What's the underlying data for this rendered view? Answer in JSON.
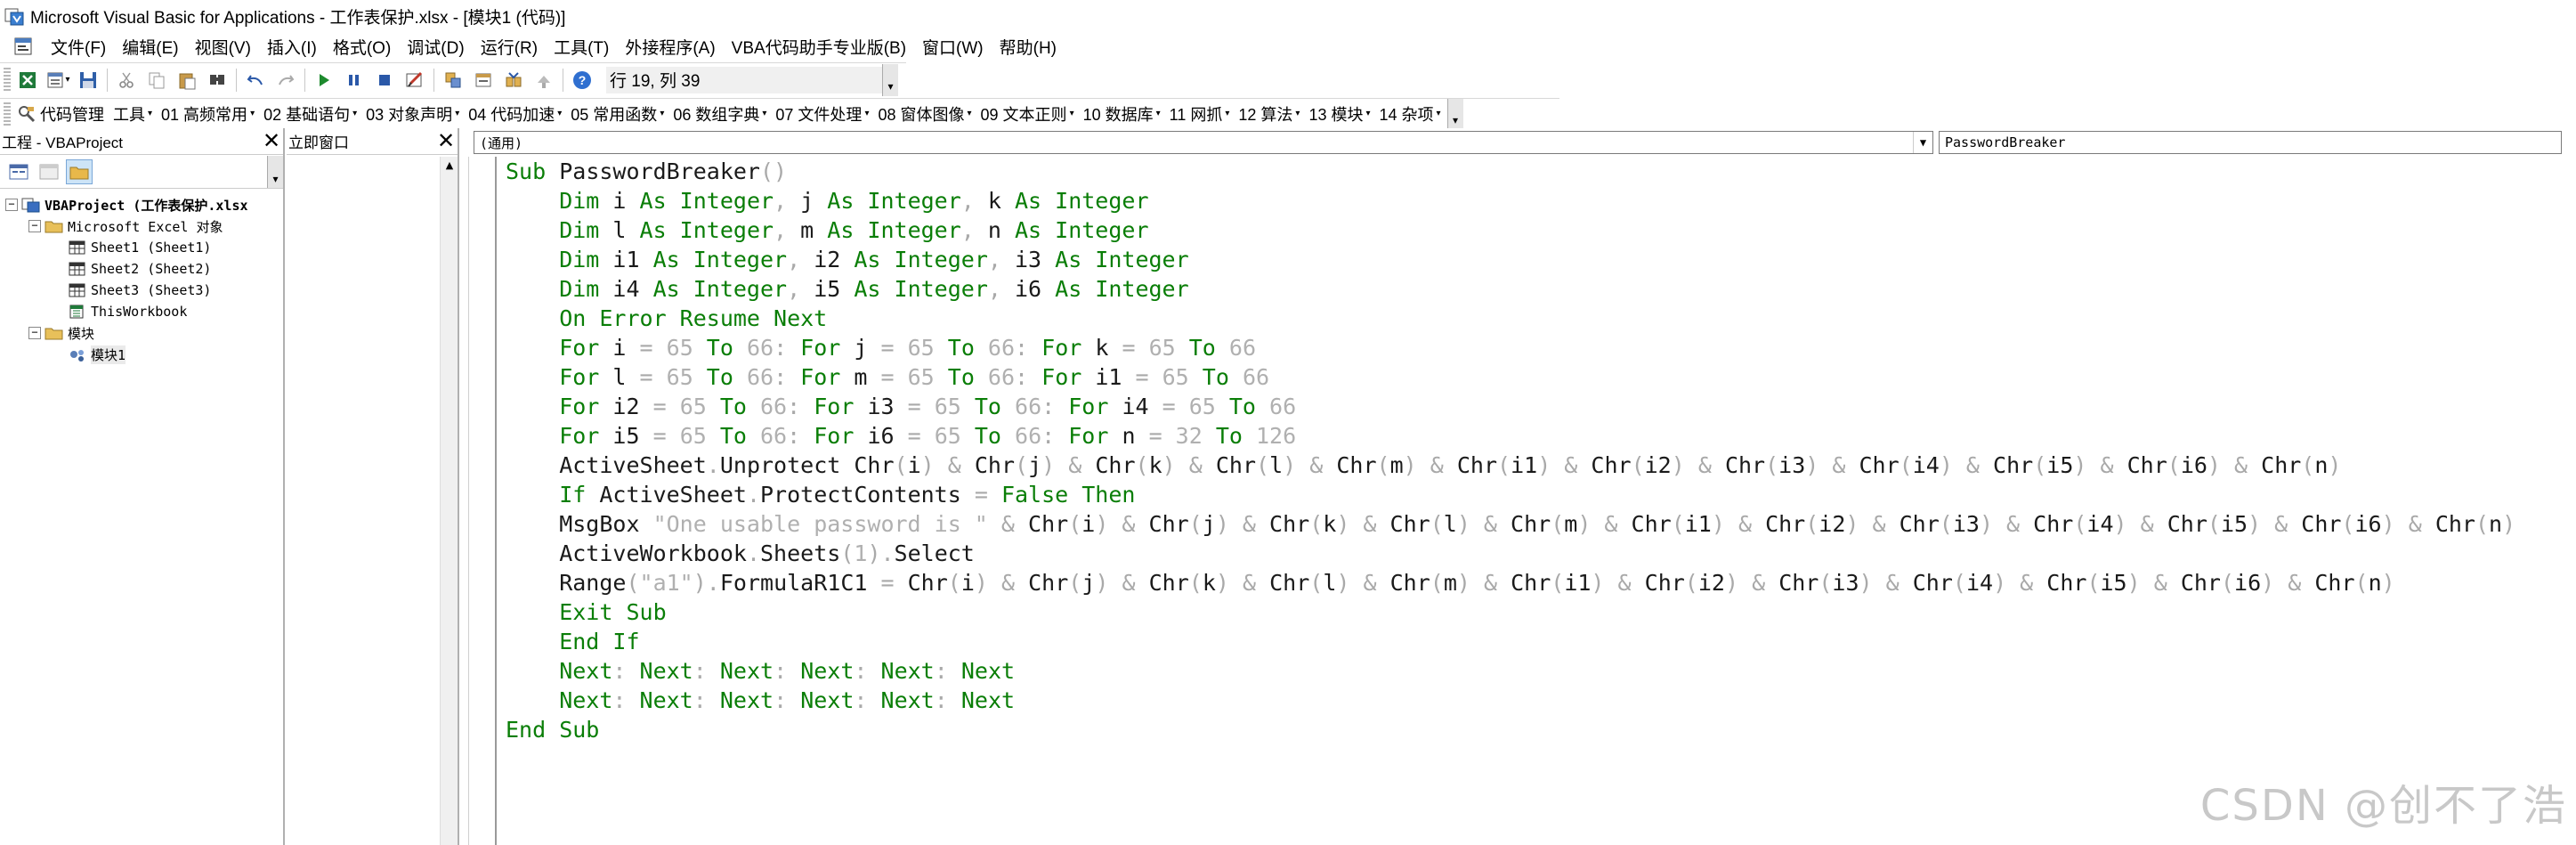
{
  "window": {
    "title": "Microsoft Visual Basic for Applications - 工作表保护.xlsx - [模块1 (代码)]"
  },
  "menu": [
    "文件(F)",
    "编辑(E)",
    "视图(V)",
    "插入(I)",
    "格式(O)",
    "调试(D)",
    "运行(R)",
    "工具(T)",
    "外接程序(A)",
    "VBA代码助手专业版(B)",
    "窗口(W)",
    "帮助(H)"
  ],
  "toolbar": {
    "icons": [
      "excel-icon",
      "insert-module-icon",
      "save-icon",
      "cut-icon",
      "copy-icon",
      "paste-icon",
      "find-icon",
      "undo-icon",
      "redo-icon",
      "run-icon",
      "break-icon",
      "reset-icon",
      "design-mode-icon",
      "project-explorer-icon",
      "properties-icon",
      "object-browser-icon",
      "toolbox-icon",
      "help-icon"
    ],
    "cursor_position": "行 19, 列 39"
  },
  "addin_toolbar": {
    "first": "代码管理",
    "items": [
      "工具",
      "01 高频常用",
      "02 基础语句",
      "03 对象声明",
      "04 代码加速",
      "05 常用函数",
      "06 数组字典",
      "07 文件处理",
      "08 窗体图像",
      "09 文本正则",
      "10 数据库",
      "11 网抓",
      "12 算法",
      "13 模块",
      "14 杂项"
    ]
  },
  "project_pane": {
    "title": "工程 - VBAProject",
    "tree": [
      {
        "label": "VBAProject (工作表保护.xlsx",
        "level": 0,
        "expander": "-",
        "icon": "vba-project-icon",
        "bold": true
      },
      {
        "label": "Microsoft Excel 对象",
        "level": 1,
        "expander": "-",
        "icon": "folder-icon"
      },
      {
        "label": "Sheet1 (Sheet1)",
        "level": 2,
        "expander": "",
        "icon": "sheet-icon"
      },
      {
        "label": "Sheet2 (Sheet2)",
        "level": 2,
        "expander": "",
        "icon": "sheet-icon"
      },
      {
        "label": "Sheet3 (Sheet3)",
        "level": 2,
        "expander": "",
        "icon": "sheet-icon"
      },
      {
        "label": "ThisWorkbook",
        "level": 2,
        "expander": "",
        "icon": "workbook-icon"
      },
      {
        "label": "模块",
        "level": 1,
        "expander": "-",
        "icon": "folder-icon"
      },
      {
        "label": "模块1",
        "level": 2,
        "expander": "",
        "icon": "module-icon",
        "selected": true
      }
    ]
  },
  "immediate_pane": {
    "title": "立即窗口"
  },
  "code_window": {
    "object_combo": "(通用)",
    "proc_combo": "PasswordBreaker",
    "lines": [
      [
        [
          "kw",
          "Sub "
        ],
        [
          "id",
          "PasswordBreaker"
        ],
        [
          "op",
          "()"
        ]
      ],
      [
        [
          "kw",
          "    Dim "
        ],
        [
          "id",
          "i "
        ],
        [
          "kw",
          "As Integer"
        ],
        [
          "op",
          ", "
        ],
        [
          "id",
          "j "
        ],
        [
          "kw",
          "As Integer"
        ],
        [
          "op",
          ", "
        ],
        [
          "id",
          "k "
        ],
        [
          "kw",
          "As Integer"
        ]
      ],
      [
        [
          "kw",
          "    Dim "
        ],
        [
          "id",
          "l "
        ],
        [
          "kw",
          "As Integer"
        ],
        [
          "op",
          ", "
        ],
        [
          "id",
          "m "
        ],
        [
          "kw",
          "As Integer"
        ],
        [
          "op",
          ", "
        ],
        [
          "id",
          "n "
        ],
        [
          "kw",
          "As Integer"
        ]
      ],
      [
        [
          "kw",
          "    Dim "
        ],
        [
          "id",
          "i1 "
        ],
        [
          "kw",
          "As Integer"
        ],
        [
          "op",
          ", "
        ],
        [
          "id",
          "i2 "
        ],
        [
          "kw",
          "As Integer"
        ],
        [
          "op",
          ", "
        ],
        [
          "id",
          "i3 "
        ],
        [
          "kw",
          "As Integer"
        ]
      ],
      [
        [
          "kw",
          "    Dim "
        ],
        [
          "id",
          "i4 "
        ],
        [
          "kw",
          "As Integer"
        ],
        [
          "op",
          ", "
        ],
        [
          "id",
          "i5 "
        ],
        [
          "kw",
          "As Integer"
        ],
        [
          "op",
          ", "
        ],
        [
          "id",
          "i6 "
        ],
        [
          "kw",
          "As Integer"
        ]
      ],
      [
        [
          "kw",
          "    On Error Resume Next"
        ]
      ],
      [
        [
          "kw",
          "    For "
        ],
        [
          "id",
          "i "
        ],
        [
          "op",
          "= "
        ],
        [
          "num",
          "65 "
        ],
        [
          "kw",
          "To "
        ],
        [
          "num",
          "66"
        ],
        [
          "op",
          ": "
        ],
        [
          "kw",
          "For "
        ],
        [
          "id",
          "j "
        ],
        [
          "op",
          "= "
        ],
        [
          "num",
          "65 "
        ],
        [
          "kw",
          "To "
        ],
        [
          "num",
          "66"
        ],
        [
          "op",
          ": "
        ],
        [
          "kw",
          "For "
        ],
        [
          "id",
          "k "
        ],
        [
          "op",
          "= "
        ],
        [
          "num",
          "65 "
        ],
        [
          "kw",
          "To "
        ],
        [
          "num",
          "66"
        ]
      ],
      [
        [
          "kw",
          "    For "
        ],
        [
          "id",
          "l "
        ],
        [
          "op",
          "= "
        ],
        [
          "num",
          "65 "
        ],
        [
          "kw",
          "To "
        ],
        [
          "num",
          "66"
        ],
        [
          "op",
          ": "
        ],
        [
          "kw",
          "For "
        ],
        [
          "id",
          "m "
        ],
        [
          "op",
          "= "
        ],
        [
          "num",
          "65 "
        ],
        [
          "kw",
          "To "
        ],
        [
          "num",
          "66"
        ],
        [
          "op",
          ": "
        ],
        [
          "kw",
          "For "
        ],
        [
          "id",
          "i1 "
        ],
        [
          "op",
          "= "
        ],
        [
          "num",
          "65 "
        ],
        [
          "kw",
          "To "
        ],
        [
          "num",
          "66"
        ]
      ],
      [
        [
          "kw",
          "    For "
        ],
        [
          "id",
          "i2 "
        ],
        [
          "op",
          "= "
        ],
        [
          "num",
          "65 "
        ],
        [
          "kw",
          "To "
        ],
        [
          "num",
          "66"
        ],
        [
          "op",
          ": "
        ],
        [
          "kw",
          "For "
        ],
        [
          "id",
          "i3 "
        ],
        [
          "op",
          "= "
        ],
        [
          "num",
          "65 "
        ],
        [
          "kw",
          "To "
        ],
        [
          "num",
          "66"
        ],
        [
          "op",
          ": "
        ],
        [
          "kw",
          "For "
        ],
        [
          "id",
          "i4 "
        ],
        [
          "op",
          "= "
        ],
        [
          "num",
          "65 "
        ],
        [
          "kw",
          "To "
        ],
        [
          "num",
          "66"
        ]
      ],
      [
        [
          "kw",
          "    For "
        ],
        [
          "id",
          "i5 "
        ],
        [
          "op",
          "= "
        ],
        [
          "num",
          "65 "
        ],
        [
          "kw",
          "To "
        ],
        [
          "num",
          "66"
        ],
        [
          "op",
          ": "
        ],
        [
          "kw",
          "For "
        ],
        [
          "id",
          "i6 "
        ],
        [
          "op",
          "= "
        ],
        [
          "num",
          "65 "
        ],
        [
          "kw",
          "To "
        ],
        [
          "num",
          "66"
        ],
        [
          "op",
          ": "
        ],
        [
          "kw",
          "For "
        ],
        [
          "id",
          "n "
        ],
        [
          "op",
          "= "
        ],
        [
          "num",
          "32 "
        ],
        [
          "kw",
          "To "
        ],
        [
          "num",
          "126"
        ]
      ],
      [
        [
          "id",
          "    ActiveSheet"
        ],
        [
          "op",
          "."
        ],
        [
          "id",
          "Unprotect Chr"
        ],
        [
          "op",
          "("
        ],
        [
          "id",
          "i"
        ],
        [
          "op",
          ") & "
        ],
        [
          "id",
          "Chr"
        ],
        [
          "op",
          "("
        ],
        [
          "id",
          "j"
        ],
        [
          "op",
          ") & "
        ],
        [
          "id",
          "Chr"
        ],
        [
          "op",
          "("
        ],
        [
          "id",
          "k"
        ],
        [
          "op",
          ") & "
        ],
        [
          "id",
          "Chr"
        ],
        [
          "op",
          "("
        ],
        [
          "id",
          "l"
        ],
        [
          "op",
          ") & "
        ],
        [
          "id",
          "Chr"
        ],
        [
          "op",
          "("
        ],
        [
          "id",
          "m"
        ],
        [
          "op",
          ") & "
        ],
        [
          "id",
          "Chr"
        ],
        [
          "op",
          "("
        ],
        [
          "id",
          "i1"
        ],
        [
          "op",
          ") & "
        ],
        [
          "id",
          "Chr"
        ],
        [
          "op",
          "("
        ],
        [
          "id",
          "i2"
        ],
        [
          "op",
          ") & "
        ],
        [
          "id",
          "Chr"
        ],
        [
          "op",
          "("
        ],
        [
          "id",
          "i3"
        ],
        [
          "op",
          ") & "
        ],
        [
          "id",
          "Chr"
        ],
        [
          "op",
          "("
        ],
        [
          "id",
          "i4"
        ],
        [
          "op",
          ") & "
        ],
        [
          "id",
          "Chr"
        ],
        [
          "op",
          "("
        ],
        [
          "id",
          "i5"
        ],
        [
          "op",
          ") & "
        ],
        [
          "id",
          "Chr"
        ],
        [
          "op",
          "("
        ],
        [
          "id",
          "i6"
        ],
        [
          "op",
          ") & "
        ],
        [
          "id",
          "Chr"
        ],
        [
          "op",
          "("
        ],
        [
          "id",
          "n"
        ],
        [
          "op",
          ")"
        ]
      ],
      [
        [
          "kw",
          "    If "
        ],
        [
          "id",
          "ActiveSheet"
        ],
        [
          "op",
          "."
        ],
        [
          "id",
          "ProtectContents "
        ],
        [
          "op",
          "= "
        ],
        [
          "kw",
          "False Then"
        ]
      ],
      [
        [
          "id",
          "    MsgBox "
        ],
        [
          "str",
          "\"One usable password is \" "
        ],
        [
          "op",
          "& "
        ],
        [
          "id",
          "Chr"
        ],
        [
          "op",
          "("
        ],
        [
          "id",
          "i"
        ],
        [
          "op",
          ") & "
        ],
        [
          "id",
          "Chr"
        ],
        [
          "op",
          "("
        ],
        [
          "id",
          "j"
        ],
        [
          "op",
          ") & "
        ],
        [
          "id",
          "Chr"
        ],
        [
          "op",
          "("
        ],
        [
          "id",
          "k"
        ],
        [
          "op",
          ") & "
        ],
        [
          "id",
          "Chr"
        ],
        [
          "op",
          "("
        ],
        [
          "id",
          "l"
        ],
        [
          "op",
          ") & "
        ],
        [
          "id",
          "Chr"
        ],
        [
          "op",
          "("
        ],
        [
          "id",
          "m"
        ],
        [
          "op",
          ") & "
        ],
        [
          "id",
          "Chr"
        ],
        [
          "op",
          "("
        ],
        [
          "id",
          "i1"
        ],
        [
          "op",
          ") & "
        ],
        [
          "id",
          "Chr"
        ],
        [
          "op",
          "("
        ],
        [
          "id",
          "i2"
        ],
        [
          "op",
          ") & "
        ],
        [
          "id",
          "Chr"
        ],
        [
          "op",
          "("
        ],
        [
          "id",
          "i3"
        ],
        [
          "op",
          ") & "
        ],
        [
          "id",
          "Chr"
        ],
        [
          "op",
          "("
        ],
        [
          "id",
          "i4"
        ],
        [
          "op",
          ") & "
        ],
        [
          "id",
          "Chr"
        ],
        [
          "op",
          "("
        ],
        [
          "id",
          "i5"
        ],
        [
          "op",
          ") & "
        ],
        [
          "id",
          "Chr"
        ],
        [
          "op",
          "("
        ],
        [
          "id",
          "i6"
        ],
        [
          "op",
          ") & "
        ],
        [
          "id",
          "Chr"
        ],
        [
          "op",
          "("
        ],
        [
          "id",
          "n"
        ],
        [
          "op",
          ")"
        ]
      ],
      [
        [
          "id",
          "    ActiveWorkbook"
        ],
        [
          "op",
          "."
        ],
        [
          "id",
          "Sheets"
        ],
        [
          "op",
          "("
        ],
        [
          "num",
          "1"
        ],
        [
          "op",
          ")."
        ],
        [
          "id",
          "Select"
        ]
      ],
      [
        [
          "id",
          "    Range"
        ],
        [
          "op",
          "("
        ],
        [
          "str",
          "\"a1\""
        ],
        [
          "op",
          ")."
        ],
        [
          "id",
          "FormulaR1C1 "
        ],
        [
          "op",
          "= "
        ],
        [
          "id",
          "Chr"
        ],
        [
          "op",
          "("
        ],
        [
          "id",
          "i"
        ],
        [
          "op",
          ") & "
        ],
        [
          "id",
          "Chr"
        ],
        [
          "op",
          "("
        ],
        [
          "id",
          "j"
        ],
        [
          "op",
          ") & "
        ],
        [
          "id",
          "Chr"
        ],
        [
          "op",
          "("
        ],
        [
          "id",
          "k"
        ],
        [
          "op",
          ") & "
        ],
        [
          "id",
          "Chr"
        ],
        [
          "op",
          "("
        ],
        [
          "id",
          "l"
        ],
        [
          "op",
          ") & "
        ],
        [
          "id",
          "Chr"
        ],
        [
          "op",
          "("
        ],
        [
          "id",
          "m"
        ],
        [
          "op",
          ") & "
        ],
        [
          "id",
          "Chr"
        ],
        [
          "op",
          "("
        ],
        [
          "id",
          "i1"
        ],
        [
          "op",
          ") & "
        ],
        [
          "id",
          "Chr"
        ],
        [
          "op",
          "("
        ],
        [
          "id",
          "i2"
        ],
        [
          "op",
          ") & "
        ],
        [
          "id",
          "Chr"
        ],
        [
          "op",
          "("
        ],
        [
          "id",
          "i3"
        ],
        [
          "op",
          ") & "
        ],
        [
          "id",
          "Chr"
        ],
        [
          "op",
          "("
        ],
        [
          "id",
          "i4"
        ],
        [
          "op",
          ") & "
        ],
        [
          "id",
          "Chr"
        ],
        [
          "op",
          "("
        ],
        [
          "id",
          "i5"
        ],
        [
          "op",
          ") & "
        ],
        [
          "id",
          "Chr"
        ],
        [
          "op",
          "("
        ],
        [
          "id",
          "i6"
        ],
        [
          "op",
          ") & "
        ],
        [
          "id",
          "Chr"
        ],
        [
          "op",
          "("
        ],
        [
          "id",
          "n"
        ],
        [
          "op",
          ")"
        ]
      ],
      [
        [
          "kw",
          "    Exit Sub"
        ]
      ],
      [
        [
          "kw",
          "    End If"
        ]
      ],
      [
        [
          "kw",
          "    Next"
        ],
        [
          "op",
          ": "
        ],
        [
          "kw",
          "Next"
        ],
        [
          "op",
          ": "
        ],
        [
          "kw",
          "Next"
        ],
        [
          "op",
          ": "
        ],
        [
          "kw",
          "Next"
        ],
        [
          "op",
          ": "
        ],
        [
          "kw",
          "Next"
        ],
        [
          "op",
          ": "
        ],
        [
          "kw",
          "Next"
        ]
      ],
      [
        [
          "kw",
          "    Next"
        ],
        [
          "op",
          ": "
        ],
        [
          "kw",
          "Next"
        ],
        [
          "op",
          ": "
        ],
        [
          "kw",
          "Next"
        ],
        [
          "op",
          ": "
        ],
        [
          "kw",
          "Next"
        ],
        [
          "op",
          ": "
        ],
        [
          "kw",
          "Next"
        ],
        [
          "op",
          ": "
        ],
        [
          "kw",
          "Next"
        ]
      ],
      [
        [
          "kw",
          "End Sub"
        ]
      ]
    ]
  },
  "watermark": "CSDN @创不了浩",
  "colors": {
    "keyword": "#0a7e07",
    "operator": "#a9a9a9",
    "identifier": "#1a1a1a"
  }
}
